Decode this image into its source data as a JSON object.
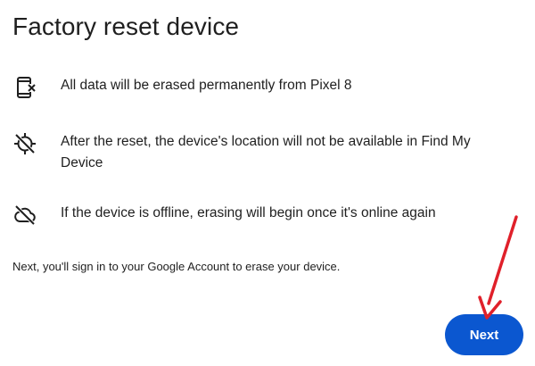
{
  "dialog": {
    "title": "Factory reset device",
    "items": [
      {
        "icon": "phone-erase-icon",
        "text": "All data will be erased permanently from Pixel 8"
      },
      {
        "icon": "location-off-icon",
        "text": "After the reset, the device's location will not be available in Find My Device"
      },
      {
        "icon": "cloud-off-icon",
        "text": "If the device is offline, erasing will begin once it's online again"
      }
    ],
    "footnote": "Next, you'll sign in to your Google Account to erase your device.",
    "next_label": "Next"
  },
  "colors": {
    "accent": "#0b57d0",
    "annotation": "#e0202a",
    "text": "#1f1f1f"
  }
}
